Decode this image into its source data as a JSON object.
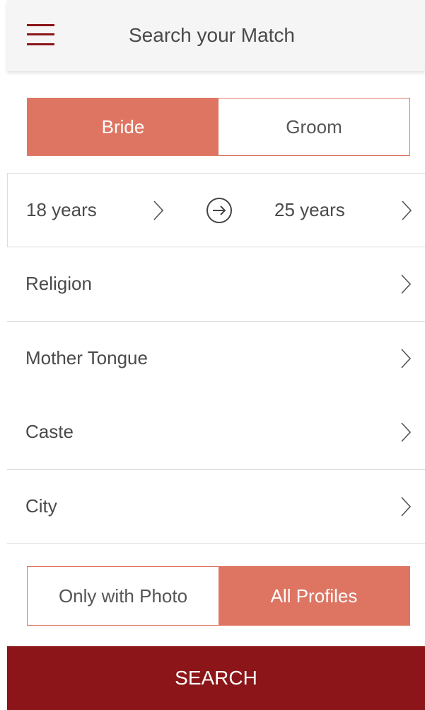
{
  "header": {
    "title": "Search your Match",
    "menu_icon": "hamburger-menu-icon"
  },
  "gender_toggle": {
    "options": [
      "Bride",
      "Groom"
    ],
    "selected": "Bride"
  },
  "age_range": {
    "from": "18 years",
    "to": "25 years"
  },
  "filters": [
    {
      "label": "Religion"
    },
    {
      "label": "Mother Tongue"
    },
    {
      "label": "Caste"
    },
    {
      "label": "City"
    }
  ],
  "photo_toggle": {
    "options": [
      "Only with Photo",
      "All Profiles"
    ],
    "selected": "All Profiles"
  },
  "search_button": {
    "label": "SEARCH"
  },
  "colors": {
    "accent": "#de7563",
    "primary": "#8b1518",
    "header_bg": "#f5f5f5",
    "divider": "#dcdcdc"
  }
}
